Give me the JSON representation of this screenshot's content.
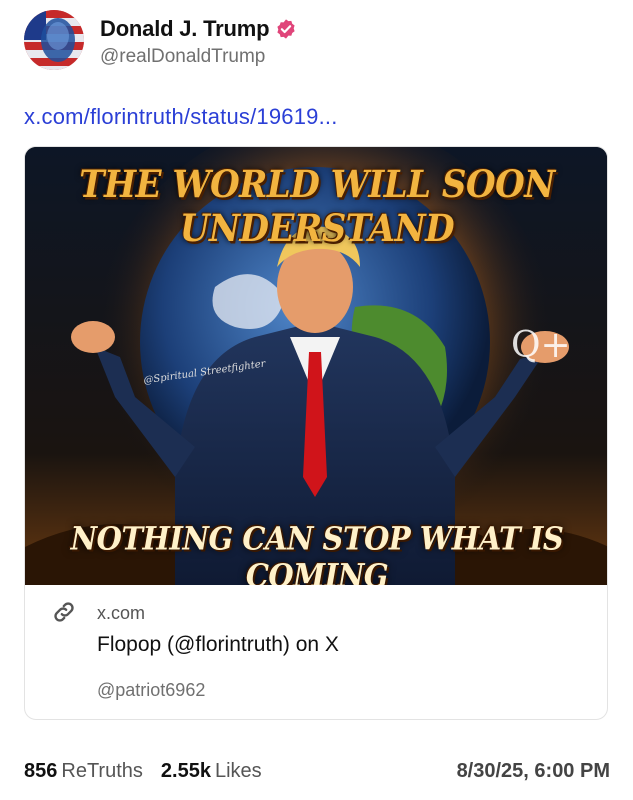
{
  "post": {
    "author": {
      "display_name": "Donald J. Trump",
      "handle": "@realDonaldTrump",
      "verified": true
    },
    "link_text": "x.com/florintruth/status/19619...",
    "card": {
      "image_top_text": "THE WORLD WILL SOON UNDERSTAND",
      "image_bottom_text": "NOTHING CAN STOP WHAT IS COMING",
      "image_watermark": "@Spiritual Streetfighter",
      "image_mark": "Q+",
      "domain": "x.com",
      "title": "Flopop (@florintruth) on X",
      "subtitle": "@patriot6962"
    },
    "stats": {
      "retruths_count": "856",
      "retruths_label": "ReTruths",
      "likes_count": "2.55k",
      "likes_label": "Likes"
    },
    "timestamp": "8/30/25, 6:00 PM"
  },
  "colors": {
    "link": "#2b3fd6",
    "verified_badge": "#e0457a",
    "text_primary": "#111111",
    "text_secondary": "#707070"
  },
  "icons": [
    "verified-badge-icon",
    "link-icon"
  ]
}
